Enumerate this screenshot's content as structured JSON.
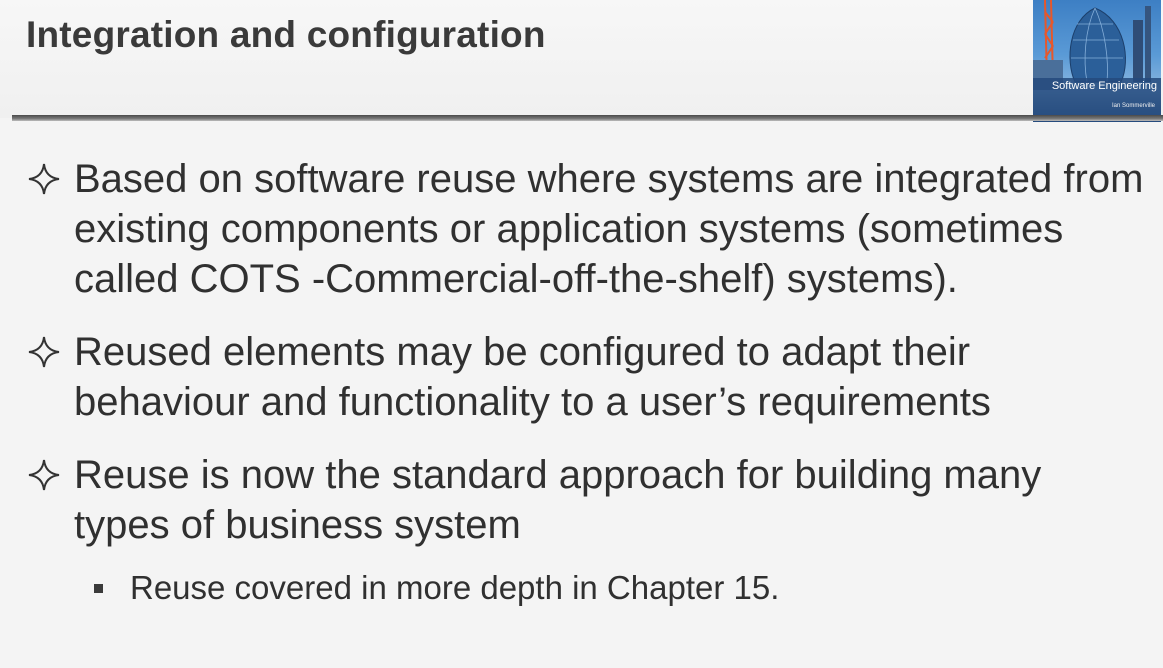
{
  "slide": {
    "title": "Integration and configuration",
    "cover": {
      "book_title": "Software Engineering",
      "author": "Ian Sommerville"
    },
    "bullets": [
      {
        "text": "Based on software reuse where systems are integrated from existing components or application systems (sometimes called COTS -Commercial-off-the-shelf) systems)."
      },
      {
        "text": "Reused elements may be configured to adapt their behaviour and functionality to a user’s requirements"
      },
      {
        "text": "Reuse is now the standard approach for building many types of business system"
      }
    ],
    "sub_bullets": [
      {
        "text": "Reuse covered in more depth in Chapter 15."
      }
    ]
  }
}
